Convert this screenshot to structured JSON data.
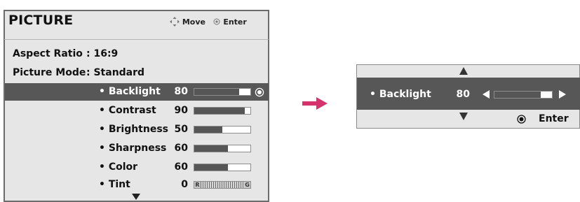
{
  "menu": {
    "title": "PICTURE",
    "hint_move": "Move",
    "hint_enter": "Enter",
    "aspect_ratio": {
      "label": "Aspect Ratio",
      "value": ": 16:9"
    },
    "picture_mode": {
      "label": "Picture Mode",
      "value": ": Standard"
    },
    "items": [
      {
        "label": "• Backlight",
        "value": "80",
        "level": 0.8,
        "selected": true
      },
      {
        "label": "• Contrast",
        "value": "90",
        "level": 0.9,
        "selected": false
      },
      {
        "label": "• Brightness",
        "value": "50",
        "level": 0.5,
        "selected": false
      },
      {
        "label": "• Sharpness",
        "value": "60",
        "level": 0.6,
        "selected": false
      },
      {
        "label": "• Color",
        "value": "60",
        "level": 0.6,
        "selected": false
      },
      {
        "label": "• Tint",
        "value": "0",
        "tint_left": "R",
        "tint_right": "G",
        "selected": false
      }
    ]
  },
  "adjust": {
    "label": "• Backlight",
    "value": "80",
    "level": 0.8,
    "enter_label": "Enter"
  },
  "colors": {
    "panel_bg": "#e6e6e6",
    "selected_bg": "#575757",
    "arrow": "#d6336c",
    "bar_fill": "#565656"
  }
}
